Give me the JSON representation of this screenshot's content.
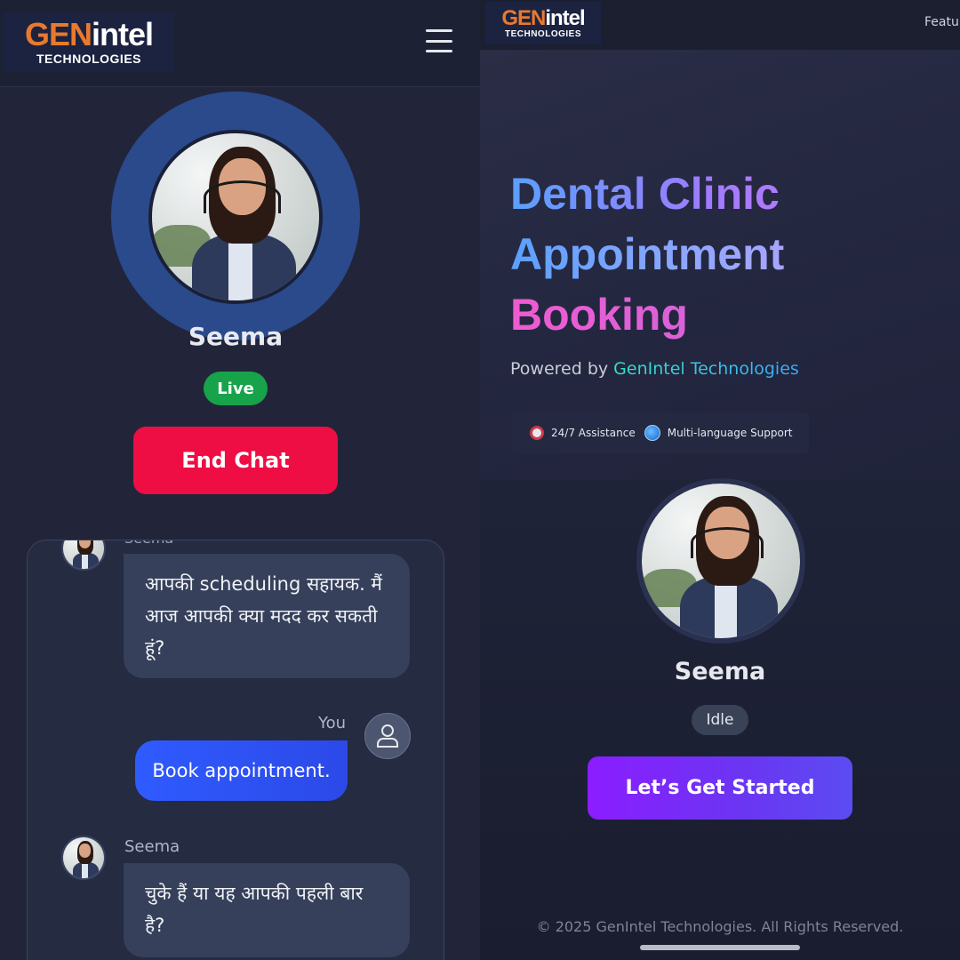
{
  "left": {
    "logo": {
      "gen": "GEN",
      "intel": "intel",
      "sub": "TECHNOLOGIES"
    },
    "agent": {
      "name": "Seema",
      "status": "Live"
    },
    "end_chat_label": "End Chat",
    "chat": {
      "peek_name": "Seema",
      "messages": [
        {
          "text": "आपकी scheduling सहायक. मैं आज आपकी क्या मदद कर सकती हूं?"
        },
        {
          "sender": "You",
          "text": "Book appointment."
        },
        {
          "sender": "Seema",
          "text": "चुके हैं या यह आपकी पहली बार है?"
        }
      ]
    }
  },
  "right": {
    "logo": {
      "gen": "GEN",
      "intel": "intel",
      "sub": "TECHNOLOGIES"
    },
    "nav_feature": "Featur",
    "hero": {
      "line1": "Dental Clinic",
      "line2": "Appointment",
      "line3": "Booking",
      "powered_prefix": "Powered by ",
      "powered_brand": "GenIntel Technologies",
      "features": [
        "24/7 Assistance",
        "Multi-language Support"
      ]
    },
    "agent": {
      "name": "Seema",
      "status": "Idle"
    },
    "start_label": "Let’s Get Started",
    "footer": "© 2025 GenIntel Technologies. All Rights Reserved."
  },
  "colors": {
    "live": "#16a34a",
    "end_chat": "#ee0e44",
    "start_gradient_from": "#8b1dff",
    "start_gradient_to": "#5b4cf2",
    "user_bubble": "#2f5bff"
  }
}
